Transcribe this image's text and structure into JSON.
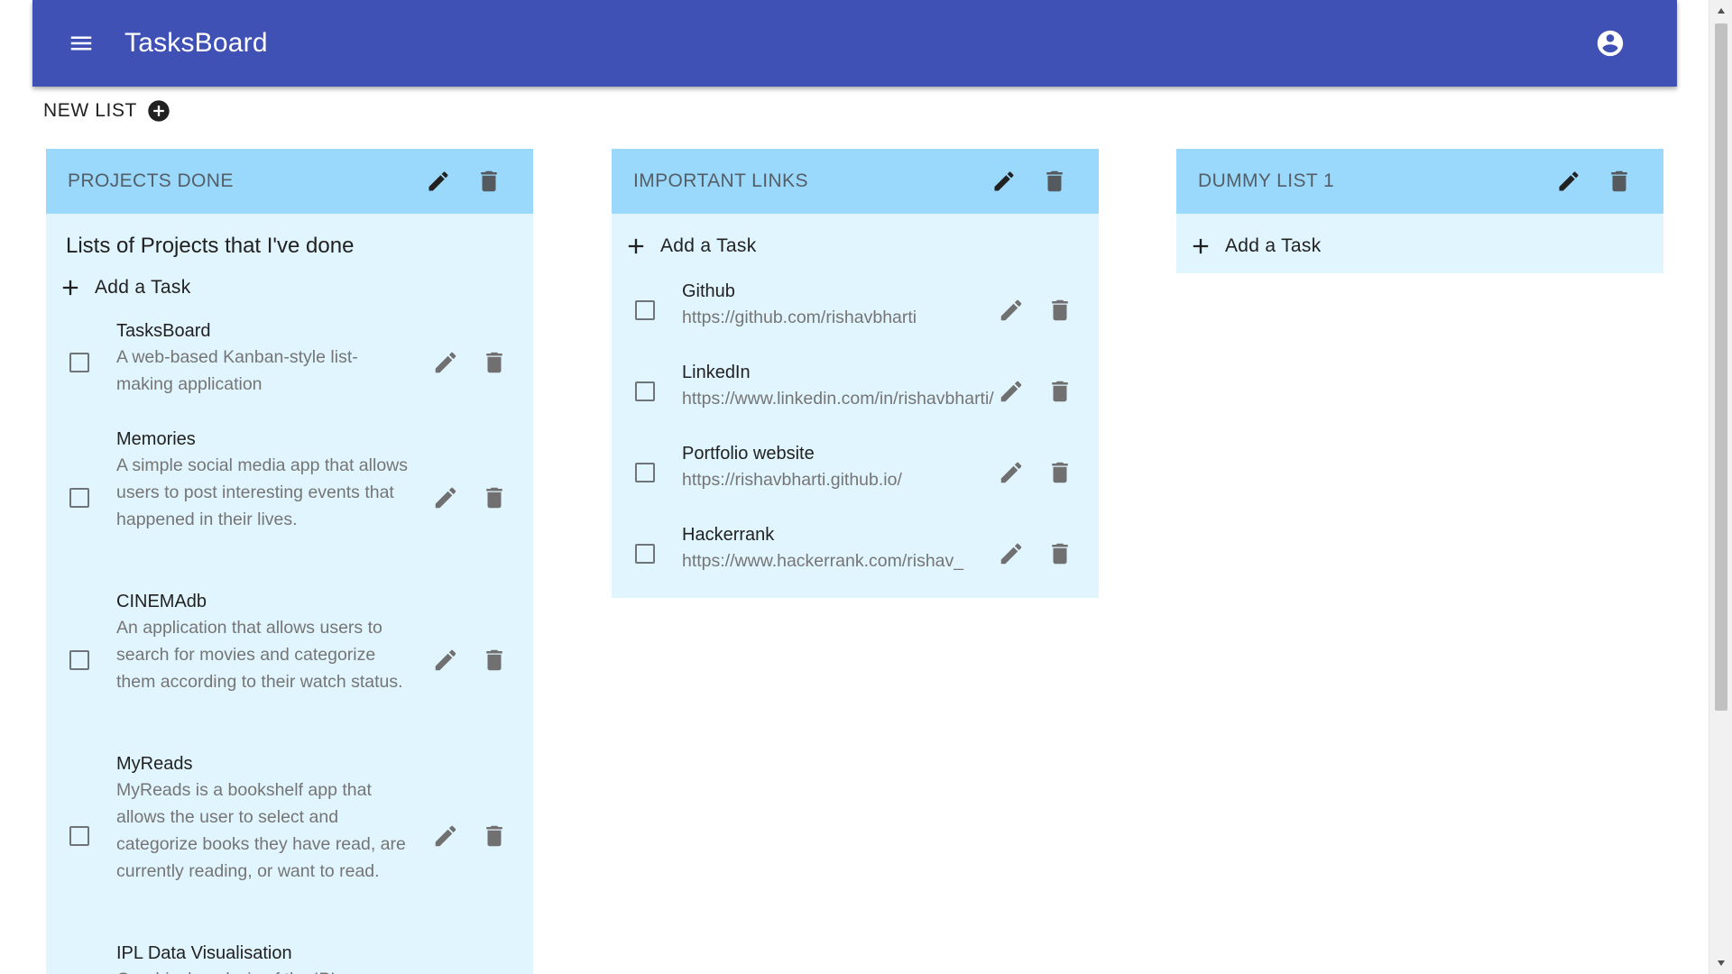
{
  "app": {
    "title": "TasksBoard"
  },
  "new_list": {
    "label": "NEW LIST"
  },
  "lists": [
    {
      "title": "PROJECTS DONE",
      "description": "Lists of Projects that I've done",
      "add_task_label": "Add a Task",
      "tasks": [
        {
          "title": "TasksBoard",
          "body": "A web-based Kanban-style list-making application"
        },
        {
          "title": "Memories",
          "body": "A simple social media app that allows users to post interesting events that happened in their lives."
        },
        {
          "title": "CINEMAdb",
          "body": "An application that allows users to search for movies and categorize them according to their watch status."
        },
        {
          "title": "MyReads",
          "body": "MyReads is a bookshelf app that allows the user to select and categorize books they have read, are currently reading, or want to read."
        },
        {
          "title": "IPL Data Visualisation",
          "body": "Graphical analysis of the IPL"
        }
      ]
    },
    {
      "title": "IMPORTANT LINKS",
      "add_task_label": "Add a Task",
      "tasks": [
        {
          "title": "Github",
          "body": "https://github.com/rishavbharti"
        },
        {
          "title": "LinkedIn",
          "body": "https://www.linkedin.com/in/rishavbharti/"
        },
        {
          "title": "Portfolio website",
          "body": "https://rishavbharti.github.io/"
        },
        {
          "title": "Hackerrank",
          "body": "https://www.hackerrank.com/rishav_"
        }
      ]
    },
    {
      "title": "DUMMY LIST 1",
      "add_task_label": "Add a Task",
      "tasks": []
    }
  ],
  "colors": {
    "app_bar": "#3f51b5",
    "list_header": "#9ad9fb",
    "list_body": "#e1f5fe"
  },
  "icons": {
    "menu": "menu-icon",
    "account": "account-circle-icon",
    "add": "add-circle-icon",
    "plus": "plus-icon",
    "edit": "pencil-icon",
    "delete": "trash-icon",
    "checkbox": "checkbox-unchecked-icon"
  }
}
